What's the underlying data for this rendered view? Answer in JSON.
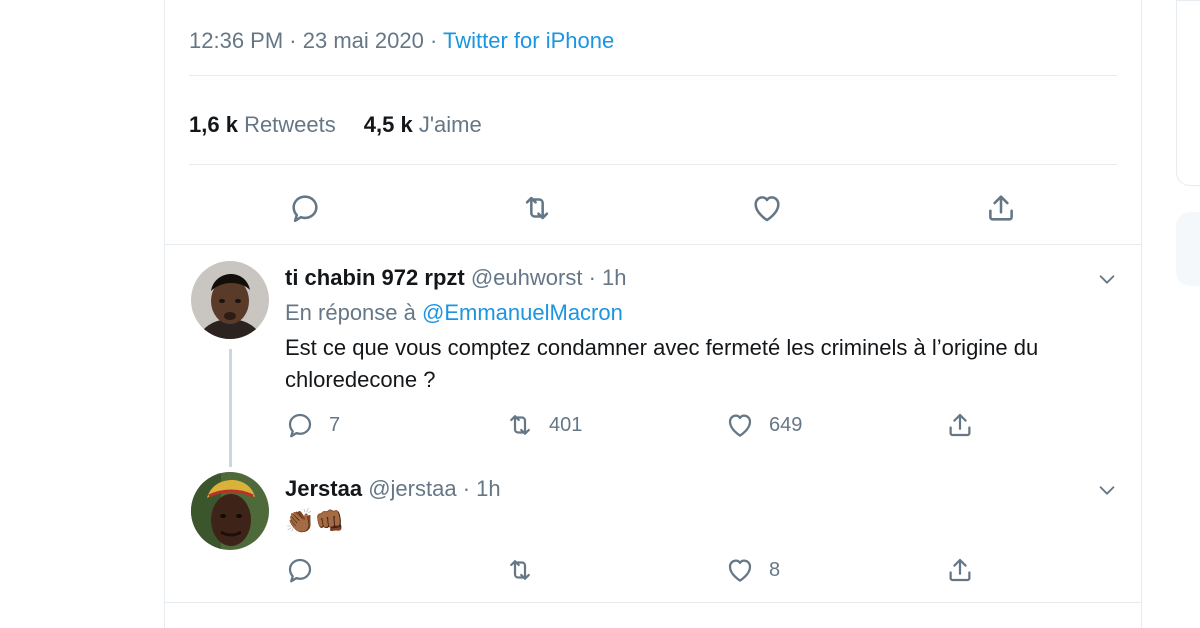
{
  "tweet": {
    "time": "12:36 PM",
    "separator": "·",
    "date": "23 mai 2020",
    "source": "Twitter for iPhone",
    "retweets_count": "1,6 k",
    "retweets_label": "Retweets",
    "likes_count": "4,5 k",
    "likes_label": "J'aime"
  },
  "replies": [
    {
      "name": "ti chabin 972 rpzt",
      "handle": "@euhworst",
      "dot": "·",
      "time": "1h",
      "reply_prefix": "En réponse à",
      "reply_mention": "@EmmanuelMacron",
      "text": "Est ce que vous comptez condamner avec fermeté les criminels à l’origine du chloredecone ?",
      "reply_count": "7",
      "retweet_count": "401",
      "like_count": "649"
    },
    {
      "name": "Jerstaa",
      "handle": "@jerstaa",
      "dot": "·",
      "time": "1h",
      "text": "👏🏾👊🏾",
      "like_count": "8"
    }
  ],
  "colors": {
    "accent": "#1b95e0",
    "secondary_text": "#657786",
    "divider": "#e6ecf0"
  },
  "icons": [
    "reply-icon",
    "retweet-icon",
    "like-icon",
    "share-icon",
    "chevron-down-icon"
  ]
}
